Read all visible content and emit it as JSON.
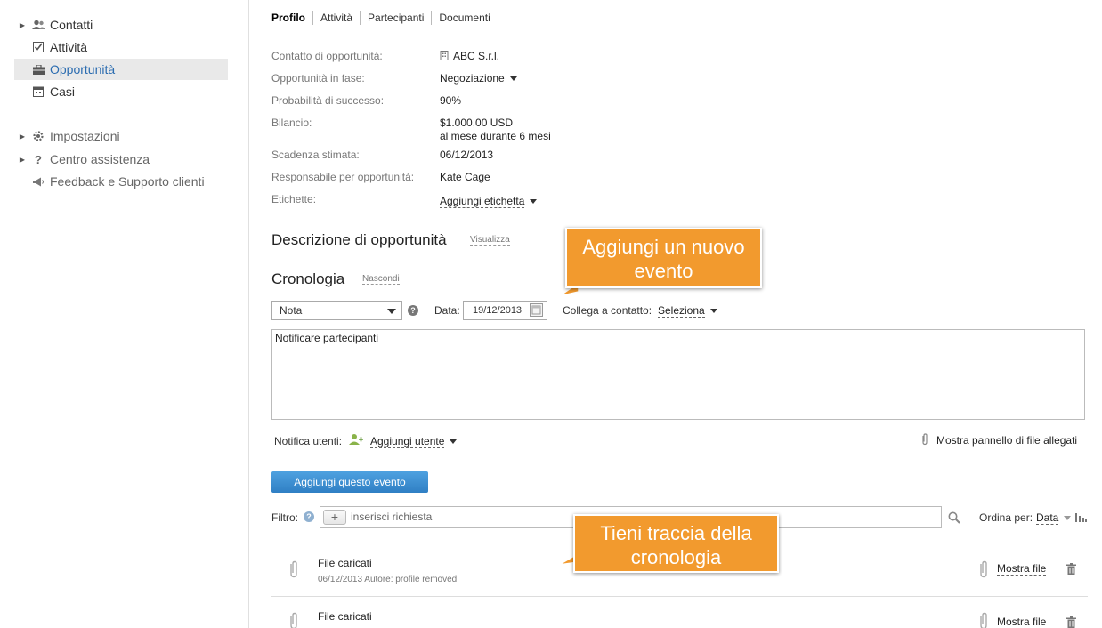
{
  "sidebar": {
    "items": [
      {
        "label": "Contatti",
        "icon": "users-icon"
      },
      {
        "label": "Attività",
        "icon": "checkbox-icon"
      },
      {
        "label": "Opportunità",
        "icon": "briefcase-icon"
      },
      {
        "label": "Casi",
        "icon": "calendar-icon"
      },
      {
        "label": "Impostazioni",
        "icon": "gear-icon"
      },
      {
        "label": "Centro assistenza",
        "icon": "question-icon"
      },
      {
        "label": "Feedback e Supporto clienti",
        "icon": "megaphone-icon"
      }
    ]
  },
  "tabs": [
    "Profilo",
    "Attività",
    "Partecipanti",
    "Documenti"
  ],
  "fields": {
    "contact": {
      "label": "Contatto di opportunità:",
      "value": "ABC S.r.l."
    },
    "stage": {
      "label": "Opportunità in fase:",
      "value": "Negoziazione"
    },
    "probability": {
      "label": "Probabilità di successo:",
      "value": "90%"
    },
    "balance": {
      "label": "Bilancio:",
      "value": "$1.000,00 USD",
      "value2": "al mese durante 6 mesi"
    },
    "deadline": {
      "label": "Scadenza stimata:",
      "value": "06/12/2013"
    },
    "owner": {
      "label": "Responsabile per opportunità:",
      "value": "Kate Cage"
    },
    "tags": {
      "label": "Etichette:",
      "value": "Aggiungi etichetta"
    }
  },
  "description": {
    "title": "Descrizione di opportunità",
    "link": "Visualizza"
  },
  "history": {
    "title": "Cronologia",
    "link": "Nascondi",
    "event_type": "Nota",
    "date_label": "Data:",
    "date_value": "19/12/2013",
    "link_contact_label": "Collega a contatto:",
    "link_contact_value": "Seleziona",
    "note_text": "Notificare partecipanti",
    "notify_label": "Notifica utenti:",
    "add_user": "Aggiungi utente",
    "attachments_link": "Mostra pannello di file allegati",
    "add_event_button": "Aggiungi questo evento",
    "filter_label": "Filtro:",
    "filter_placeholder": "inserisci richiesta",
    "sort_label": "Ordina per:",
    "sort_value": "Data",
    "rows": [
      {
        "title": "File caricati",
        "meta": "06/12/2013 Autore: profile removed",
        "action": "Mostra file"
      },
      {
        "title": "File caricati",
        "meta": "",
        "action": "Mostra file"
      }
    ]
  },
  "callouts": {
    "new_event": "Aggiungi un nuovo evento",
    "track_history": "Tieni traccia della cronologia"
  },
  "colors": {
    "accent": "#2f7fc4",
    "callout": "#f29a2e",
    "active_nav": "#e9e9e9"
  }
}
